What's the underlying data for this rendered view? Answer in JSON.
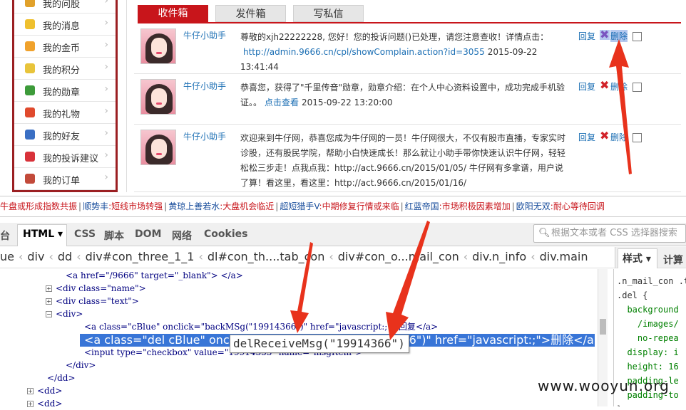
{
  "sidebar": {
    "items": [
      {
        "label": "我的问股",
        "icon": "question-icon",
        "color": "#e1a12a"
      },
      {
        "label": "我的消息",
        "icon": "message-icon",
        "color": "#efc02e"
      },
      {
        "label": "我的金币",
        "icon": "coin-icon",
        "color": "#f0a22c"
      },
      {
        "label": "我的积分",
        "icon": "points-icon",
        "color": "#e8c43b"
      },
      {
        "label": "我的勋章",
        "icon": "medal-icon",
        "color": "#3d9b3a"
      },
      {
        "label": "我的礼物",
        "icon": "gift-icon",
        "color": "#e04a2d"
      },
      {
        "label": "我的好友",
        "icon": "friends-icon",
        "color": "#3a6fc4"
      },
      {
        "label": "我的投诉建议",
        "icon": "complaint-icon",
        "color": "#d8323a"
      },
      {
        "label": "我的订单",
        "icon": "order-icon",
        "color": "#c24a3a"
      }
    ]
  },
  "mail_tabs": [
    "收件箱",
    "发件箱",
    "写私信"
  ],
  "messages": [
    {
      "sender": "牛仔小助手",
      "text": "尊敬的xjh22222228, 您好！您的投诉问题()已处理，请您注意查收！详情点击：",
      "link": "http://admin.9666.cn/cpl/showComplain.action?id=3055",
      "time": "2015-09-22 13:41:44",
      "reply": "回复",
      "delete": "删除"
    },
    {
      "sender": "牛仔小助手",
      "text": "恭喜您，获得了\"千里传音\"勋章，勋章介绍：在个人中心资料设置中，成功完成手机验证。。",
      "link": "点击查看",
      "time": "2015-09-22 13:20:00",
      "reply": "回复",
      "delete": "删除"
    },
    {
      "sender": "牛仔小助手",
      "text": "欢迎来到牛仔网，恭喜您成为牛仔网的一员！牛仔网很大，不仅有股市直播，专家实时诊股，还有股民学院，帮助小白快速成长！那么就让小助手带你快速认识牛仔网，轻轻松松三步走！点我点我：http://act.9666.cn/2015/01/05/ 牛仔网有多拿谱，用户说了算！看这里，看这里：http://act.9666.cn/2015/01/16/",
      "link": "",
      "time": "",
      "reply": "回复",
      "delete": "删除"
    }
  ],
  "ticker": [
    {
      "name": "",
      "text": "牛盘或形成指数共振",
      "sep": "|"
    },
    {
      "name": "顺势丰",
      "text": "短线市场转强",
      "sep": "|"
    },
    {
      "name": "黄琼上善若水",
      "text": "大盘机会临近",
      "sep": "|"
    },
    {
      "name": "超短猎手V",
      "text": "中期修复行情或来临",
      "sep": "|"
    },
    {
      "name": "红蓝帝国",
      "text": "市场积极因素增加",
      "sep": "|"
    },
    {
      "name": "欧阳无双",
      "text": "耐心等待回调",
      "sep": ""
    }
  ],
  "devtools": {
    "tabs": [
      "台",
      "HTML ▾",
      "CSS",
      "脚本",
      "DOM",
      "网络",
      "Cookies"
    ],
    "search_placeholder": "根据文本或者 CSS 选择器搜索",
    "breadcrumbs": [
      "ue",
      "div",
      "dd",
      "div#con_three_1_1",
      "dl#con_th....tab_con",
      "div#con_o...mail_con",
      "div.n_info",
      "div.main"
    ],
    "right_tabs": [
      "样式 ▾",
      "计算"
    ],
    "code_lines": [
      {
        "indent": 92,
        "text": "<a href=\"/9666\" target=\"_blank\"> </a>",
        "expander": ""
      },
      {
        "indent": 78,
        "text": "<div class=\"name\">",
        "expander": "+"
      },
      {
        "indent": 78,
        "text": "<div class=\"text\">",
        "expander": "+"
      },
      {
        "indent": 78,
        "text": "<div>",
        "expander": "−"
      },
      {
        "indent": 118,
        "text": "<a class=\"cBlue\" onclick=\"backMSg(\"19914366\")\" href=\"javascript:;\">回复</a>",
        "expander": ""
      },
      {
        "indent": 118,
        "text": "<a class=\"del cBlue\" onclick=\"delReceiveMsg(\"19914366\")\" href=\"javascript:;\">删除</a>",
        "expander": ""
      },
      {
        "indent": 118,
        "text": "<input type=\"checkbox\" value=\"19914333\" name=\"msgItem\">",
        "expander": ""
      },
      {
        "indent": 92,
        "text": "</div>",
        "expander": ""
      },
      {
        "indent": 66,
        "text": "</dd>",
        "expander": ""
      },
      {
        "indent": 52,
        "text": "<dd>",
        "expander": "+"
      },
      {
        "indent": 52,
        "text": "<dd>",
        "expander": "+"
      }
    ],
    "tooltip": "delReceiveMsg(\"19914366\")",
    "css_lines": [
      ".n_mail_con .t",
      ".del {",
      "  background",
      "    /images/",
      "    no-repea",
      "  display: i",
      "  height: 16",
      "  padding-le",
      "  padding-to",
      "}"
    ]
  },
  "watermark": "www.wooyun.org"
}
